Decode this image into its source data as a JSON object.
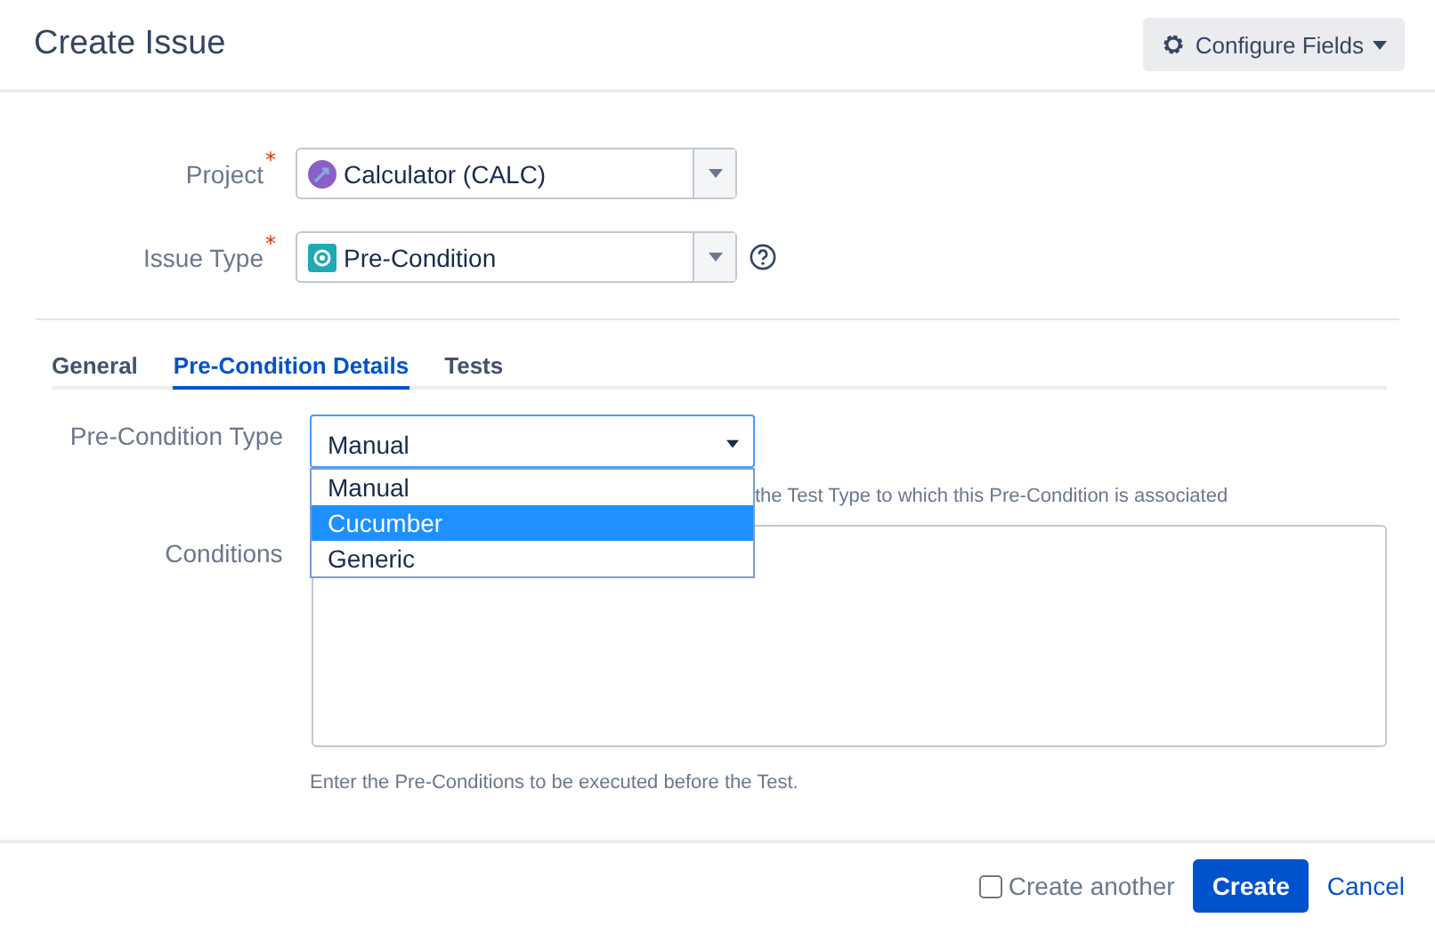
{
  "window": {
    "title": "Create Issue"
  },
  "configure_button": {
    "label": "Configure Fields"
  },
  "fields": [
    {
      "label": "Project",
      "required_mark": "*",
      "value": "Calculator (CALC)",
      "kind": "project",
      "help": false
    },
    {
      "label": "Issue Type",
      "required_mark": "*",
      "value": "Pre-Condition",
      "kind": "issuetype",
      "help": true
    }
  ],
  "tabs": [
    {
      "label": "General",
      "selected": false
    },
    {
      "label": "Pre-Condition Details",
      "selected": true
    },
    {
      "label": "Tests",
      "selected": false
    }
  ],
  "precondition_type": {
    "label": "Pre-Condition Type",
    "value": "Manual",
    "expanded": true,
    "options": [
      {
        "label": "Manual",
        "highlighted": false
      },
      {
        "label": "Cucumber",
        "highlighted": true
      },
      {
        "label": "Generic",
        "highlighted": false
      }
    ],
    "hint": "the Test Type to which this Pre-Condition is associated"
  },
  "conditions": {
    "label": "Conditions",
    "hint": "Enter the Pre-Conditions to be executed before the Test."
  },
  "footer": {
    "create_another": {
      "label": "Create another",
      "checked": false
    },
    "create_button": "Create",
    "cancel_link": "Cancel"
  }
}
